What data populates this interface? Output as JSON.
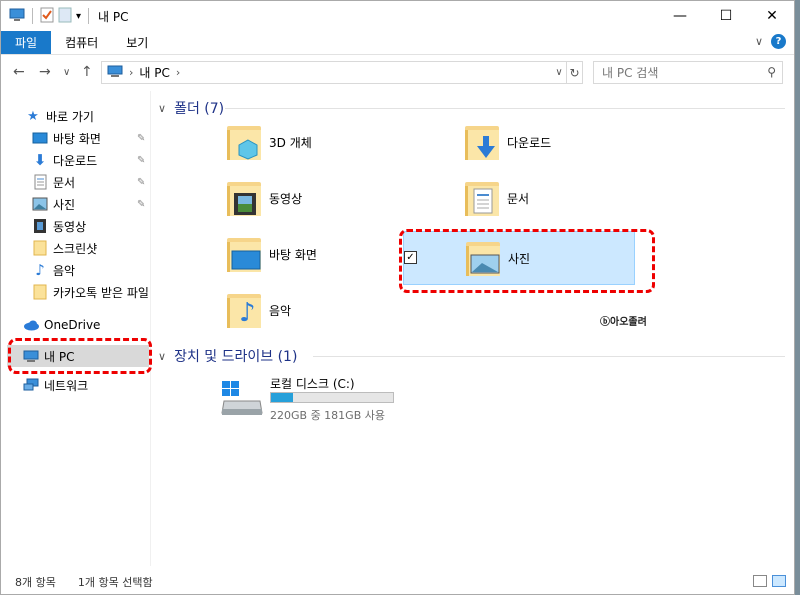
{
  "window": {
    "title": "내 PC",
    "controls": {
      "minimize": "—",
      "maximize": "☐",
      "close": "✕"
    }
  },
  "ribbon": {
    "tabs": [
      {
        "label": "파일",
        "active": true
      },
      {
        "label": "컴퓨터",
        "active": false
      },
      {
        "label": "보기",
        "active": false
      }
    ],
    "collapse": "∨",
    "help": "?"
  },
  "address": {
    "path": [
      "내 PC"
    ],
    "search_placeholder": "내 PC 검색"
  },
  "sidebar": {
    "items": [
      {
        "label": "바로 가기",
        "icon": "star-icon",
        "pinned": false
      },
      {
        "label": "바탕 화면",
        "icon": "desktop-icon",
        "pinned": true
      },
      {
        "label": "다운로드",
        "icon": "download-icon",
        "pinned": true
      },
      {
        "label": "문서",
        "icon": "document-icon",
        "pinned": true
      },
      {
        "label": "사진",
        "icon": "picture-icon",
        "pinned": true
      },
      {
        "label": "동영상",
        "icon": "video-icon",
        "pinned": false
      },
      {
        "label": "스크린샷",
        "icon": "folder-icon",
        "pinned": false
      },
      {
        "label": "음악",
        "icon": "music-icon",
        "pinned": false
      },
      {
        "label": "카카오톡 받은 파일",
        "icon": "folder-icon",
        "pinned": false
      },
      {
        "label": "OneDrive",
        "icon": "cloud-icon",
        "pinned": false
      },
      {
        "label": "내 PC",
        "icon": "computer-icon",
        "pinned": false,
        "selected": true
      },
      {
        "label": "네트워크",
        "icon": "network-icon",
        "pinned": false
      }
    ]
  },
  "content": {
    "folders_header": "폴더 (7)",
    "folders": [
      {
        "label": "3D 개체",
        "icon": "3d-objects-folder-icon"
      },
      {
        "label": "다운로드",
        "icon": "downloads-folder-icon"
      },
      {
        "label": "동영상",
        "icon": "videos-folder-icon"
      },
      {
        "label": "문서",
        "icon": "documents-folder-icon"
      },
      {
        "label": "바탕 화면",
        "icon": "desktop-folder-icon"
      },
      {
        "label": "사진",
        "icon": "pictures-folder-icon",
        "selected": true
      },
      {
        "label": "음악",
        "icon": "music-folder-icon"
      }
    ],
    "drives_header": "장치 및 드라이브 (1)",
    "drive": {
      "name": "로컬 디스크 (C:)",
      "usage": "220GB 중 181GB 사용",
      "free_fraction": 0.18
    },
    "watermark": "ⓑ아오졸려"
  },
  "status": {
    "count": "8개 항목",
    "selected": "1개 항목 선택함"
  },
  "colors": {
    "accent": "#1979ca",
    "selection": "#cce8ff",
    "annotation": "#e00000",
    "drive_bar": "#26a0da"
  }
}
